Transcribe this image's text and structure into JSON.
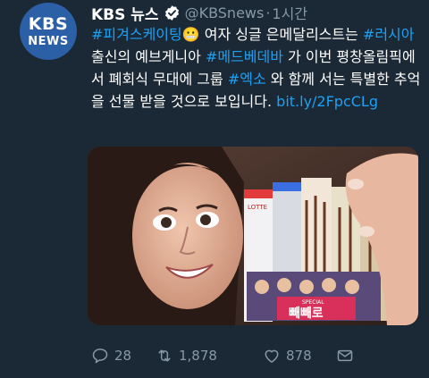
{
  "account": {
    "avatar_line1": "KBS",
    "avatar_line2": "NEWS",
    "display_name": "KBS 뉴스",
    "handle": "@KBSnews",
    "separator": "·",
    "time": "1시간"
  },
  "tweet": {
    "segments": [
      {
        "type": "tag",
        "text": "#피겨스케이팅"
      },
      {
        "type": "emoji",
        "text": "😬"
      },
      {
        "type": "text",
        "text": " 여자 싱글 은메달리스트는 "
      },
      {
        "type": "tag",
        "text": "#러시아"
      },
      {
        "type": "text",
        "text": " 출신의 예브게니아 "
      },
      {
        "type": "tag",
        "text": "#메드베데바"
      },
      {
        "type": "text",
        "text": " 가 이번 평창올림픽에서 폐회식 무대에 그룹 "
      },
      {
        "type": "tag",
        "text": "#엑소"
      },
      {
        "type": "text",
        "text": " 와 함께 서는 특별한 추억을 선물 받을 것으로 보입니다. "
      },
      {
        "type": "link",
        "text": "bit.ly/2FpcCLg"
      }
    ]
  },
  "media": {
    "package_brand": "LOTTE",
    "package_label": "SPECIAL",
    "package_title": "빼빼로"
  },
  "actions": {
    "reply_count": "28",
    "retweet_count": "1,878",
    "like_count": "878"
  },
  "colors": {
    "background": "#1b2836",
    "link": "#1da1f2",
    "muted": "#8899a6",
    "avatar": "#2b5fa6"
  }
}
